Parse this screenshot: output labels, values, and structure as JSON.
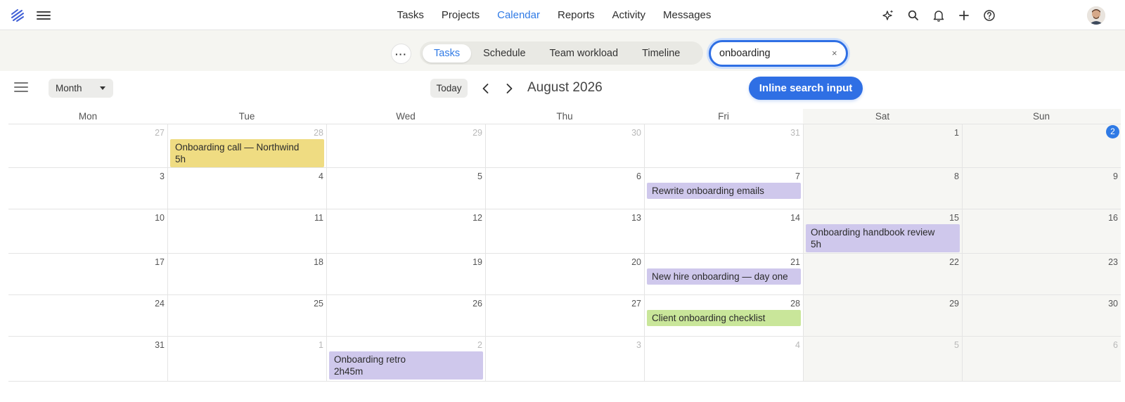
{
  "nav": {
    "items": [
      "Tasks",
      "Projects",
      "Calendar",
      "Reports",
      "Activity",
      "Messages"
    ],
    "active": "Calendar"
  },
  "toolbar_icons": [
    "sparkle-icon",
    "search-icon",
    "bell-icon",
    "plus-icon",
    "help-icon"
  ],
  "view_tabs": {
    "items": [
      "Tasks",
      "Schedule",
      "Team workload",
      "Timeline"
    ],
    "active": "Tasks"
  },
  "search": {
    "value": "onboarding",
    "clear": "×"
  },
  "calendar_toolbar": {
    "view_select": "Month",
    "today_label": "Today",
    "month_title": "August 2026",
    "pill_button": "Inline search input"
  },
  "calendar": {
    "weekdays": [
      "Mon",
      "Tue",
      "Wed",
      "Thu",
      "Fri",
      "Sat",
      "Sun"
    ],
    "today": "2",
    "weeks": [
      {
        "days": [
          {
            "n": "27",
            "other": true
          },
          {
            "n": "28",
            "other": true,
            "events": [
              {
                "title": "Onboarding call — Northwind",
                "duration": "5h",
                "color": "yellow"
              }
            ]
          },
          {
            "n": "29",
            "other": true
          },
          {
            "n": "30",
            "other": true
          },
          {
            "n": "31",
            "other": true
          },
          {
            "n": "1"
          },
          {
            "n": "2",
            "today": true
          }
        ]
      },
      {
        "days": [
          {
            "n": "3"
          },
          {
            "n": "4"
          },
          {
            "n": "5"
          },
          {
            "n": "6"
          },
          {
            "n": "7",
            "events": [
              {
                "title": "Rewrite onboarding emails",
                "color": "purple"
              }
            ]
          },
          {
            "n": "8"
          },
          {
            "n": "9"
          }
        ]
      },
      {
        "days": [
          {
            "n": "10"
          },
          {
            "n": "11"
          },
          {
            "n": "12"
          },
          {
            "n": "13"
          },
          {
            "n": "14"
          },
          {
            "n": "15",
            "events": [
              {
                "title": "Onboarding handbook review",
                "duration": "5h",
                "color": "purple"
              }
            ]
          },
          {
            "n": "16"
          }
        ]
      },
      {
        "days": [
          {
            "n": "17"
          },
          {
            "n": "18"
          },
          {
            "n": "19"
          },
          {
            "n": "20"
          },
          {
            "n": "21",
            "events": [
              {
                "title": "New hire onboarding — day one",
                "color": "purple"
              }
            ]
          },
          {
            "n": "22"
          },
          {
            "n": "23"
          }
        ]
      },
      {
        "days": [
          {
            "n": "24"
          },
          {
            "n": "25"
          },
          {
            "n": "26"
          },
          {
            "n": "27"
          },
          {
            "n": "28",
            "events": [
              {
                "title": "Client onboarding checklist",
                "color": "green"
              }
            ]
          },
          {
            "n": "29"
          },
          {
            "n": "30"
          }
        ]
      },
      {
        "days": [
          {
            "n": "31"
          },
          {
            "n": "1",
            "other": true
          },
          {
            "n": "2",
            "other": true,
            "events": [
              {
                "title": "Onboarding retro",
                "duration": "2h45m",
                "color": "purple"
              }
            ]
          },
          {
            "n": "3",
            "other": true
          },
          {
            "n": "4",
            "other": true
          },
          {
            "n": "5",
            "other": true
          },
          {
            "n": "6",
            "other": true
          }
        ]
      }
    ]
  },
  "colors": {
    "accent": "#2f7ae5",
    "event_yellow": "#efdc82",
    "event_purple": "#cfc8ec",
    "event_green": "#c9e69a"
  }
}
